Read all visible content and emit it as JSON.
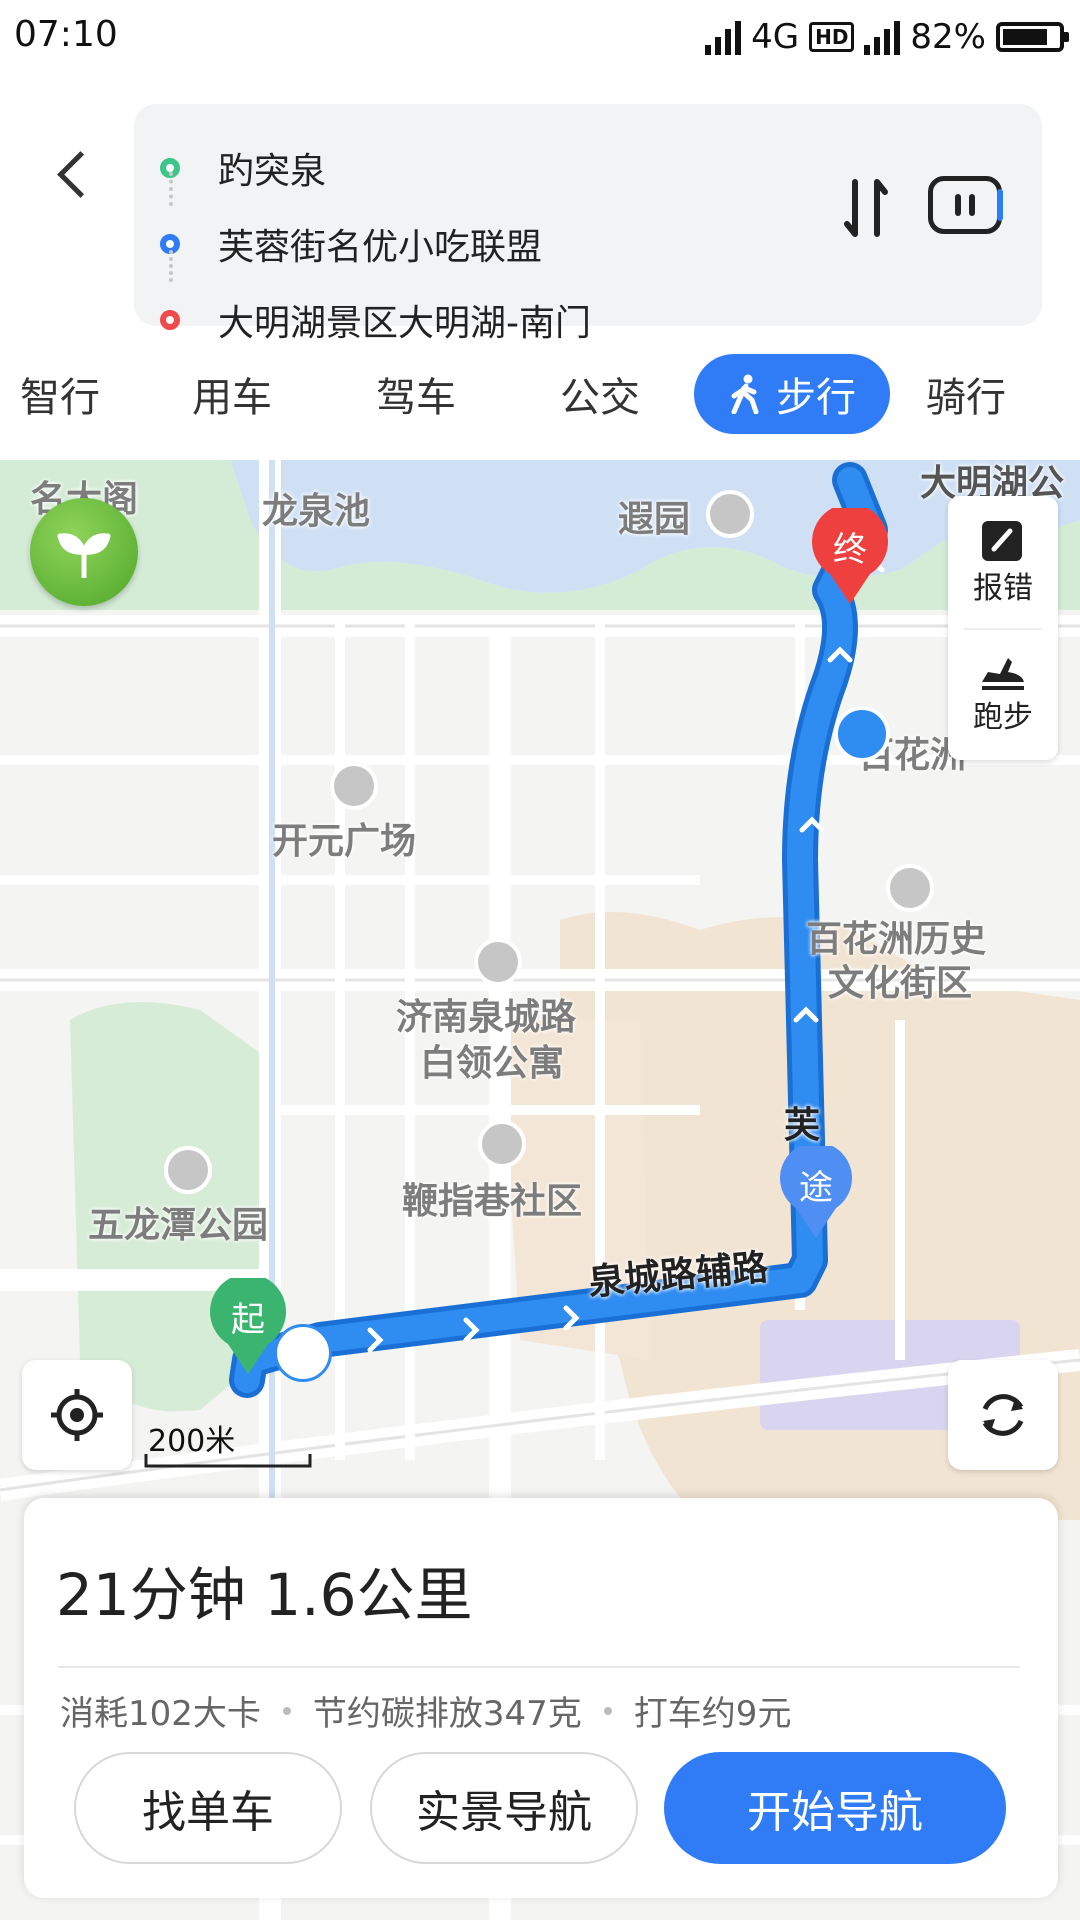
{
  "status_bar": {
    "time": "07:10",
    "network": "4G",
    "hd": "HD",
    "battery": "82%",
    "battery_level": 0.82
  },
  "header": {
    "stops": [
      {
        "label": "趵突泉",
        "color": "#3ec58a"
      },
      {
        "label": "芙蓉街名优小吃联盟",
        "color": "#2f7cf6"
      },
      {
        "label": "大明湖景区大明湖-南门",
        "color": "#f04a4a"
      }
    ]
  },
  "tabs": [
    {
      "label": "智行"
    },
    {
      "label": "用车"
    },
    {
      "label": "驾车"
    },
    {
      "label": "公交"
    },
    {
      "label": "步行",
      "active": true
    },
    {
      "label": "骑行"
    }
  ],
  "map": {
    "labels": {
      "mingda": "名大阁",
      "longquan": "龙泉池",
      "xia": "遐园",
      "daminghu": "大明湖公",
      "kaiyuan": "开元广场",
      "baihuazhou": "百花洲",
      "baihua_hist_1": "百花洲历史",
      "baihua_hist_2": "文化街区",
      "jinan_1": "济南泉城路",
      "jinan_2": "白领公寓",
      "bianzhi": "鞭指巷社区",
      "wulongtan": "五龙潭公园",
      "fu": "芙",
      "road": "泉城路辅路",
      "scale": "200米"
    },
    "markers": {
      "start": "起",
      "via": "途",
      "end": "终"
    },
    "side_buttons": {
      "report": "报错",
      "run": "跑步"
    },
    "colors": {
      "route": "#2f8cf0",
      "start": "#3ab46e",
      "via": "#4f8ef2",
      "end": "#ef4040"
    }
  },
  "summary": {
    "duration_distance": "21分钟  1.6公里",
    "calories": "消耗102大卡",
    "carbon": "节约碳排放347克",
    "taxi": "打车约9元"
  },
  "actions": {
    "bike": "找单车",
    "ar_nav": "实景导航",
    "start_nav": "开始导航"
  }
}
